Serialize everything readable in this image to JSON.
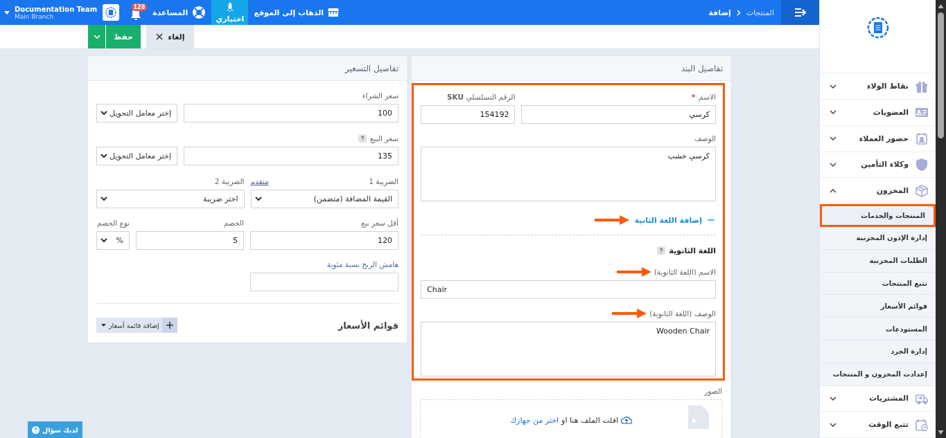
{
  "topbar": {
    "breadcrumb": [
      "المنتجات",
      "إضافة"
    ],
    "links": [
      {
        "label": "الذهاب إلى الموقع",
        "kind": "store",
        "selected": false
      },
      {
        "label": "اختياري",
        "kind": "rocket",
        "selected": true
      },
      {
        "label": "المساعدة",
        "kind": "help",
        "selected": false
      }
    ],
    "notifications": "128",
    "user": {
      "name": "Documentation Team",
      "branch": "Main Branch"
    }
  },
  "actions": {
    "cancel": "إلغاء",
    "save": "حفظ"
  },
  "item_details": {
    "title": "تفاصيل البند",
    "highlighted": true,
    "name": {
      "label": "الاسم",
      "required_mark": "*",
      "value": "كرسي"
    },
    "sku": {
      "label": "الرقم التسلسلي **SKU**",
      "value": "154192"
    },
    "description": {
      "label": "الوصف",
      "value": "كرسي خشب"
    },
    "second_language_toggle": {
      "label": "إضافة اللغة الثانية",
      "expanded": true,
      "pointed": true
    },
    "secondary": {
      "title": "اللغة الثانوية",
      "name": {
        "label": "الاسم (اللغة الثانوية)",
        "value": "Chair",
        "pointed": true
      },
      "description": {
        "label": "الوصف (اللغة الثانوية)",
        "value": "Wooden Chair",
        "pointed": true
      }
    },
    "images": {
      "label": "الصور",
      "drop_text": "افلت الملف هنا او",
      "browse_link": "اختر من جهازك"
    }
  },
  "pricing": {
    "title": "تفاصيل التسعير",
    "purchase_price": {
      "label": "سعر الشراء",
      "value": "100",
      "unit": "إختر معامل التحويل"
    },
    "sale_price": {
      "label": "سعر البيع",
      "value": "135",
      "unit": "إختر معامل التحويل",
      "help": true
    },
    "tax1": {
      "label": "الضريبة 1",
      "value": "القيمة المضافة (متضمن)"
    },
    "advanced_link": "متقدم",
    "tax2": {
      "label": "الضريبة 2",
      "value": "اختر ضريبة"
    },
    "min_price": {
      "label": "أقل سعر بيع",
      "value": "120"
    },
    "discount": {
      "label": "الخصم",
      "value": "5"
    },
    "discount_type": {
      "label": "نوع الخصم",
      "value": "%"
    },
    "profit_margin": {
      "label": "هامش الربح نسبة مئوية"
    },
    "price_lists": {
      "title": "قوائم الأسعار",
      "add_button": "إضافة قائمة أسعار"
    }
  },
  "sidebar": {
    "items": [
      {
        "label": "نقاط الولاء",
        "kind": "gift",
        "expanded": false
      },
      {
        "label": "العضويات",
        "kind": "card",
        "expanded": false
      },
      {
        "label": "حضور العملاء",
        "kind": "calendar",
        "expanded": false
      },
      {
        "label": "وكلاء التأمين",
        "kind": "shield",
        "expanded": false
      },
      {
        "label": "المخزون",
        "kind": "box",
        "expanded": true,
        "children": [
          {
            "label": "المنتجات والخدمات",
            "selected": true,
            "highlighted": true
          },
          {
            "label": "إدارة الإذون المخزنية",
            "selected": false,
            "highlighted": false
          },
          {
            "label": "الطلبات المخزنية",
            "selected": false,
            "highlighted": false
          },
          {
            "label": "تتبع المنتجات",
            "selected": false,
            "highlighted": false
          },
          {
            "label": "قوائم الأسعار",
            "selected": false,
            "highlighted": false
          },
          {
            "label": "المستودعات",
            "selected": false,
            "highlighted": false
          },
          {
            "label": "إدارة الجرد",
            "selected": false,
            "highlighted": false
          },
          {
            "label": "إعدادت المخزون و المنتجات",
            "selected": false,
            "highlighted": false
          }
        ]
      },
      {
        "label": "المشتريات",
        "kind": "truck",
        "expanded": false
      },
      {
        "label": "تتبع الوقت",
        "kind": "clock",
        "expanded": false
      }
    ]
  },
  "help_button": "لديك سؤال"
}
